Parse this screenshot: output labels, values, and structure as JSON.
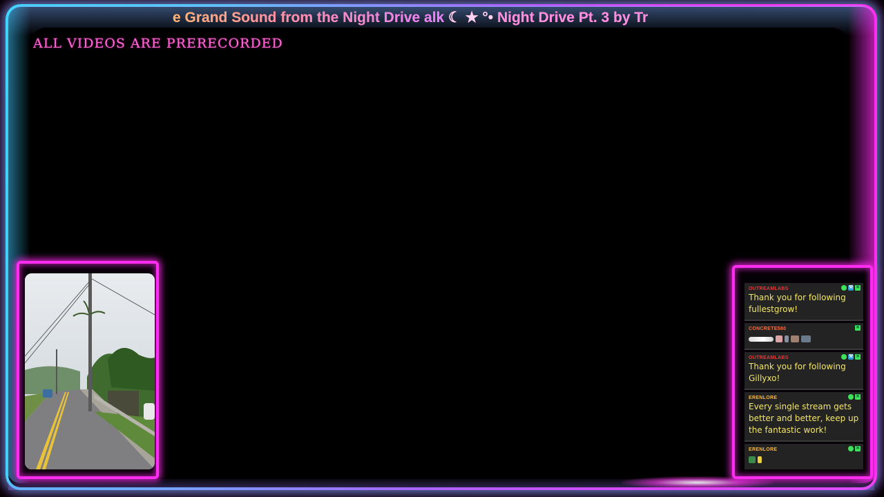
{
  "ticker": {
    "text_main": "e Grand Sound from the Night Drive alk",
    "text_symbols": " ☾ ★ °• ",
    "text_tail": "Night Drive Pt. 3 by Tr"
  },
  "notice": {
    "text": "ALL VIDEOS ARE PRERECORDED"
  },
  "camera": {
    "icon": "dashcam-road-view"
  },
  "chat": {
    "messages": [
      {
        "user": "OUTREAMLABS",
        "user_color": "#e23a3a",
        "text": "Thank you for following fullestgrow!",
        "badges": [
          "green",
          "blue",
          "x"
        ]
      },
      {
        "user": "CONCRETE580",
        "user_color": "#ff6a3a",
        "text": "",
        "badges": [
          "x"
        ],
        "emotes": true
      },
      {
        "user": "OUTREAMLABS",
        "user_color": "#e23a3a",
        "text": "Thank you for following Gillyxo!",
        "badges": [
          "green",
          "blue",
          "x"
        ]
      },
      {
        "user": "ERENLORE",
        "user_color": "#ffb62e",
        "text": "Every single stream gets better and better, keep up the fantastic work!",
        "badges": [
          "green",
          "x"
        ]
      },
      {
        "user": "ERENLORE",
        "user_color": "#ffb62e",
        "text": "",
        "badges": [
          "green",
          "x"
        ],
        "emotes_small": true
      }
    ]
  },
  "colors": {
    "neon_pink": "#ff2df0",
    "neon_blue": "#3fd8ff",
    "notice_pink": "#ff6ad6",
    "chat_text": "#f3e66a"
  }
}
